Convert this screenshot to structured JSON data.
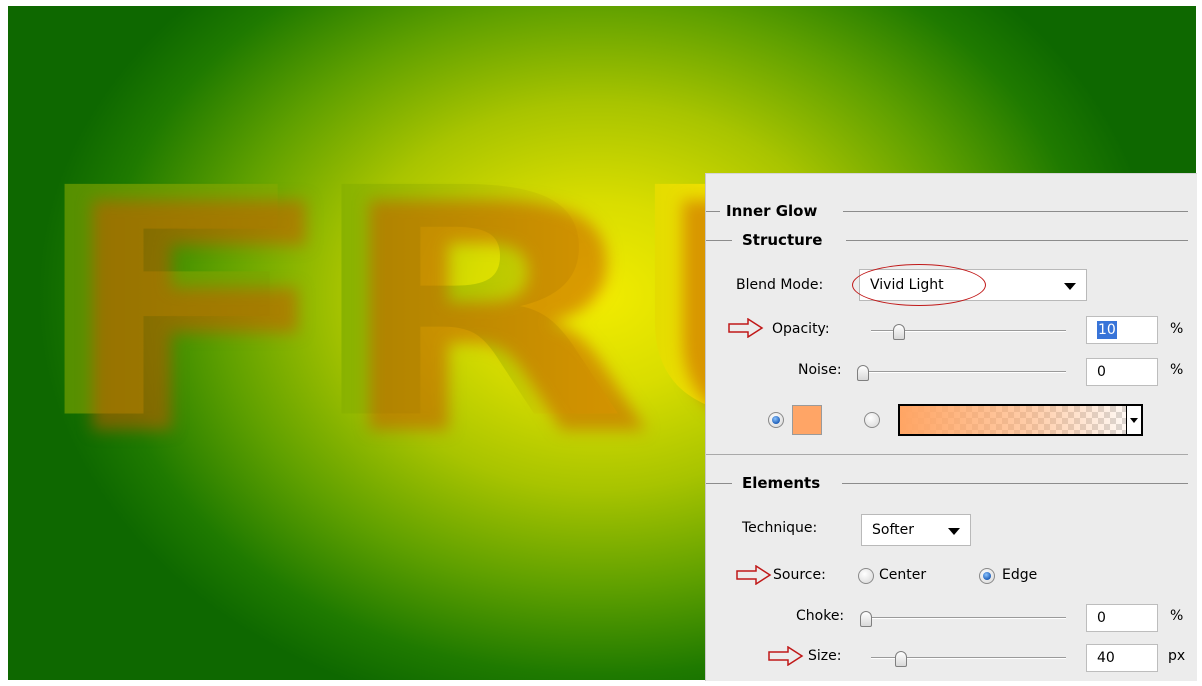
{
  "artwork": {
    "text": "FRU",
    "colors": {
      "bg_center": "#f2ec00",
      "bg_edge": "#0e6800",
      "glow": "#c85a00"
    }
  },
  "panel": {
    "title": "Inner Glow",
    "structure": {
      "heading": "Structure",
      "blend_mode_label": "Blend Mode:",
      "blend_mode_value": "Vivid Light",
      "opacity_label": "Opacity:",
      "opacity_value": "10",
      "opacity_unit": "%",
      "opacity_level": 0.1,
      "noise_label": "Noise:",
      "noise_value": "0",
      "noise_unit": "%",
      "noise_level": 0.0,
      "glow_color": "#ffa566",
      "gradient_color": "#ffa566"
    },
    "elements": {
      "heading": "Elements",
      "technique_label": "Technique:",
      "technique_value": "Softer",
      "source_label": "Source:",
      "source_center": "Center",
      "source_edge": "Edge",
      "source_selected": "Edge",
      "choke_label": "Choke:",
      "choke_value": "0",
      "choke_unit": "%",
      "choke_level": 0.0,
      "size_label": "Size:",
      "size_value": "40",
      "size_unit": "px",
      "size_level": 0.16
    },
    "annotation_color": "#c01818"
  }
}
